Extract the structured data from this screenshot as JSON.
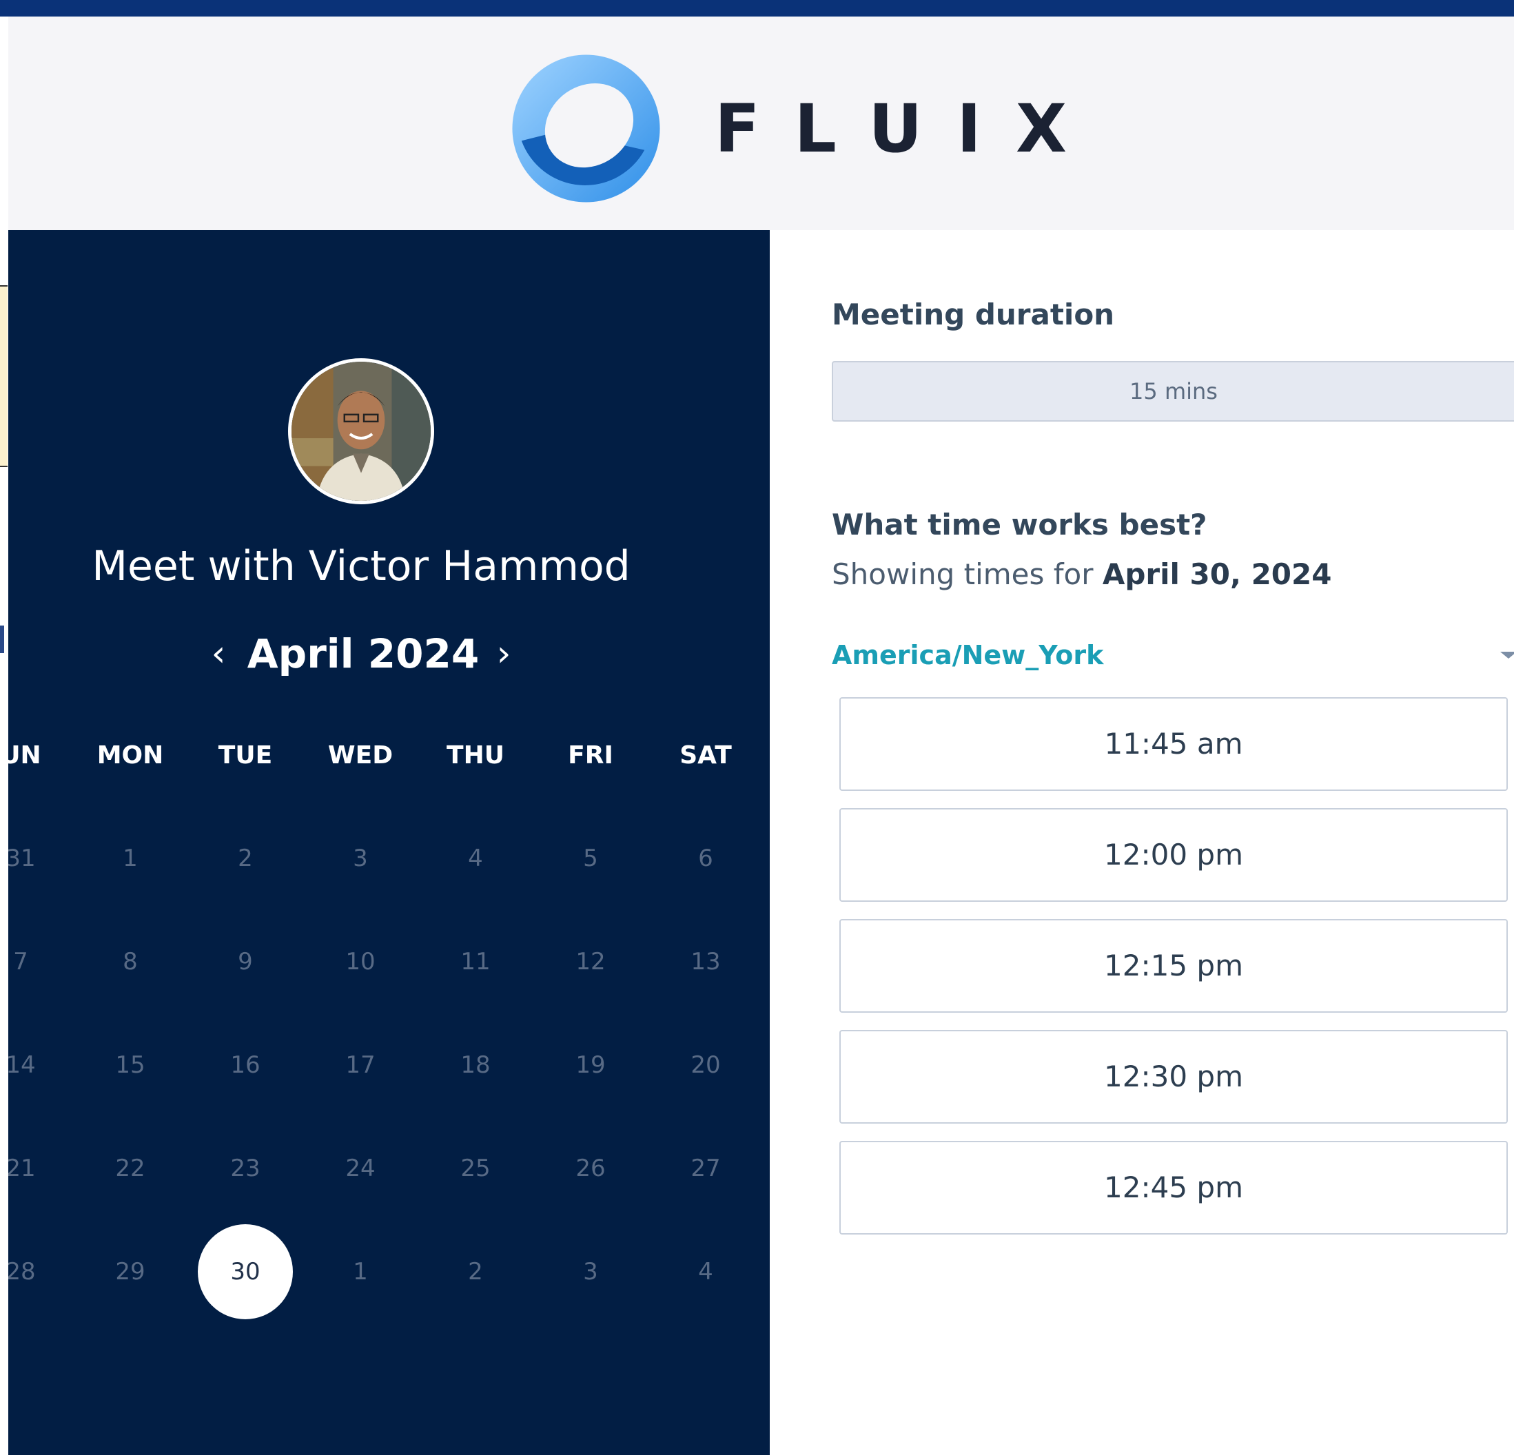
{
  "brand": {
    "logo_text": "FLUIX",
    "primary_color": "#0a3278",
    "panel_color": "#021e44",
    "accent_color": "#1a9eb5"
  },
  "host": {
    "title": "Meet with Victor Hammod"
  },
  "calendar": {
    "month_label": "April 2024",
    "prev_icon": "chevron-left-icon",
    "next_icon": "chevron-right-icon",
    "weekdays": [
      "UN",
      "MON",
      "TUE",
      "WED",
      "THU",
      "FRI",
      "SAT"
    ],
    "weeks": [
      [
        "31",
        "1",
        "2",
        "3",
        "4",
        "5",
        "6"
      ],
      [
        "7",
        "8",
        "9",
        "10",
        "11",
        "12",
        "13"
      ],
      [
        "14",
        "15",
        "16",
        "17",
        "18",
        "19",
        "20"
      ],
      [
        "21",
        "22",
        "23",
        "24",
        "25",
        "26",
        "27"
      ],
      [
        "28",
        "29",
        "30",
        "1",
        "2",
        "3",
        "4"
      ]
    ],
    "selected_day": "30"
  },
  "booking": {
    "duration_label": "Meeting duration",
    "duration_value": "15 mins",
    "time_question": "What time works best?",
    "showing_prefix": "Showing times for",
    "showing_date": "April 30, 2024",
    "timezone": "America/New_York",
    "timezone_icon": "caret-down-icon",
    "slots": [
      "11:45 am",
      "12:00 pm",
      "12:15 pm",
      "12:30 pm",
      "12:45 pm"
    ]
  }
}
